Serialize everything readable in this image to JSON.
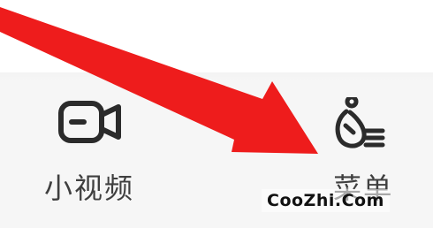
{
  "tabs": [
    {
      "label": "小视频",
      "icon": "video-camera-icon"
    },
    {
      "label": "菜单",
      "icon": "user-menu-icon"
    }
  ],
  "annotation": {
    "arrow_color": "#ee1c1c"
  },
  "watermark": {
    "text": "CooZhi.Com"
  },
  "colors": {
    "icon": "#2b2b2b",
    "label": "#3f3f3f",
    "background": "#f6f6f6"
  }
}
